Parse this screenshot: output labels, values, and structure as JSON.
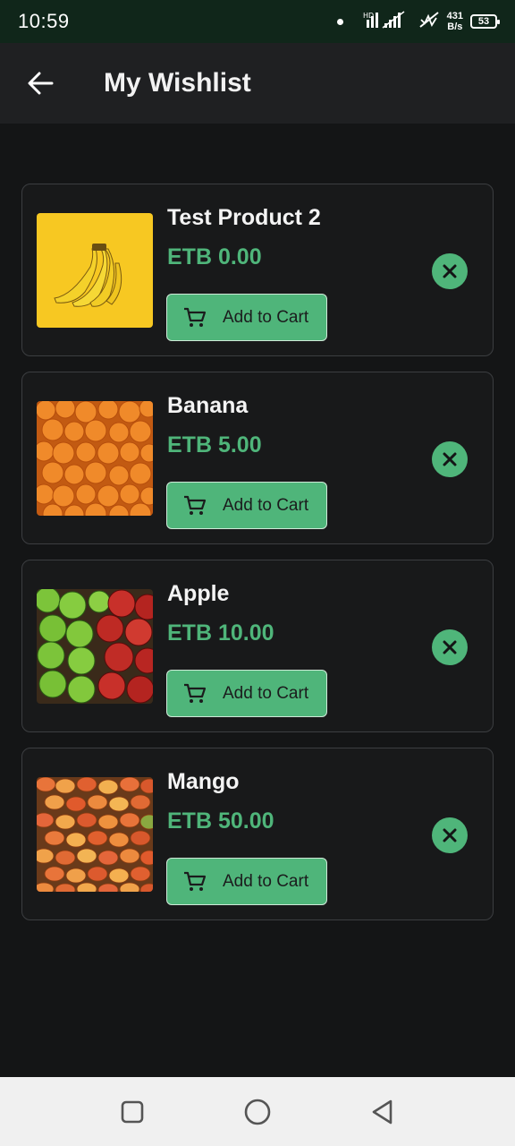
{
  "status_bar": {
    "time": "10:59",
    "net_speed_value": "431",
    "net_speed_unit": "B/s",
    "battery": "53"
  },
  "app_bar": {
    "title": "My Wishlist",
    "back_icon": "arrow-left-icon"
  },
  "wishlist": {
    "add_to_cart_label": "Add to Cart",
    "items": [
      {
        "name": "Test Product 2",
        "price": "ETB 0.00",
        "image": "bananas"
      },
      {
        "name": "Banana",
        "price": "ETB 5.00",
        "image": "oranges"
      },
      {
        "name": "Apple",
        "price": "ETB 10.00",
        "image": "apples"
      },
      {
        "name": "Mango",
        "price": "ETB 50.00",
        "image": "mangoes"
      }
    ]
  },
  "colors": {
    "accent": "#4fb57a",
    "background": "#141516",
    "app_bar": "#1f2022",
    "status_bar": "#10261a"
  },
  "nav_bar": {
    "icons": [
      "recents-square-icon",
      "home-circle-icon",
      "back-triangle-icon"
    ]
  }
}
